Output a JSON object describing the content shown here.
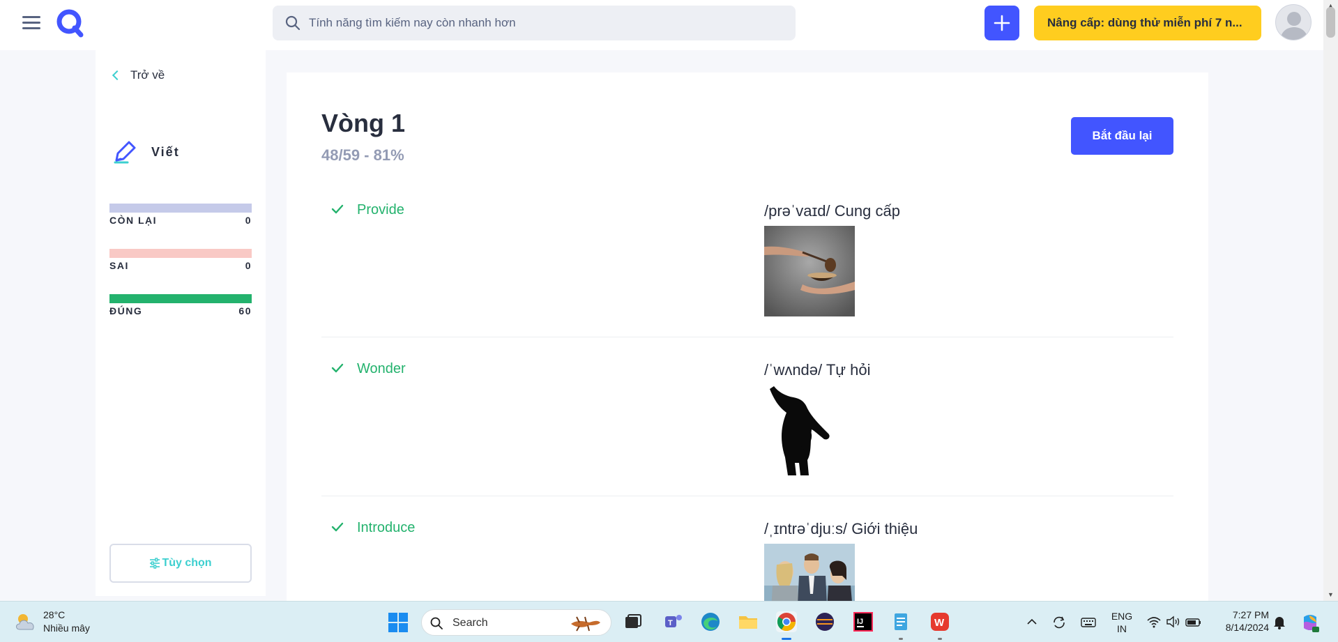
{
  "header": {
    "search_placeholder": "Tính năng tìm kiếm nay còn nhanh hơn",
    "upgrade_label": "Nâng cấp: dùng thử miễn phí 7 n..."
  },
  "sidebar": {
    "back_label": "Trở về",
    "mode_label": "Viết",
    "stats": [
      {
        "label": "CÒN LẠI",
        "value": "0",
        "color": "#c5cae9"
      },
      {
        "label": "SAI",
        "value": "0",
        "color": "#f9c9c5"
      },
      {
        "label": "ĐÚNG",
        "value": "60",
        "color": "#23b26d"
      }
    ],
    "options_label": "Tùy chọn"
  },
  "main": {
    "round_title": "Vòng 1",
    "round_score": "48/59 - 81%",
    "restart_label": "Bắt đầu lại",
    "terms": [
      {
        "word": "Provide",
        "definition": "/prəˈvaɪd/ Cung cấp",
        "image": "hand-ladling-soup-photo"
      },
      {
        "word": "Wonder",
        "definition": "/ˈwʌndə/ Tự hỏi",
        "image": "wondering-figure-silhouette"
      },
      {
        "word": "Introduce",
        "definition": "/ˌɪntrəˈdjuːs/ Giới thiệu",
        "image": "people-introduction-photo"
      }
    ]
  },
  "taskbar": {
    "weather_temp": "28°C",
    "weather_desc": "Nhiều mây",
    "search_label": "Search",
    "lang_top": "ENG",
    "lang_bottom": "IN",
    "time": "7:27 PM",
    "date": "8/14/2024"
  },
  "colors": {
    "brand": "#4255ff",
    "accent_teal": "#3ccfcf",
    "correct_green": "#23b26d",
    "upgrade_yellow": "#ffcd1f"
  }
}
